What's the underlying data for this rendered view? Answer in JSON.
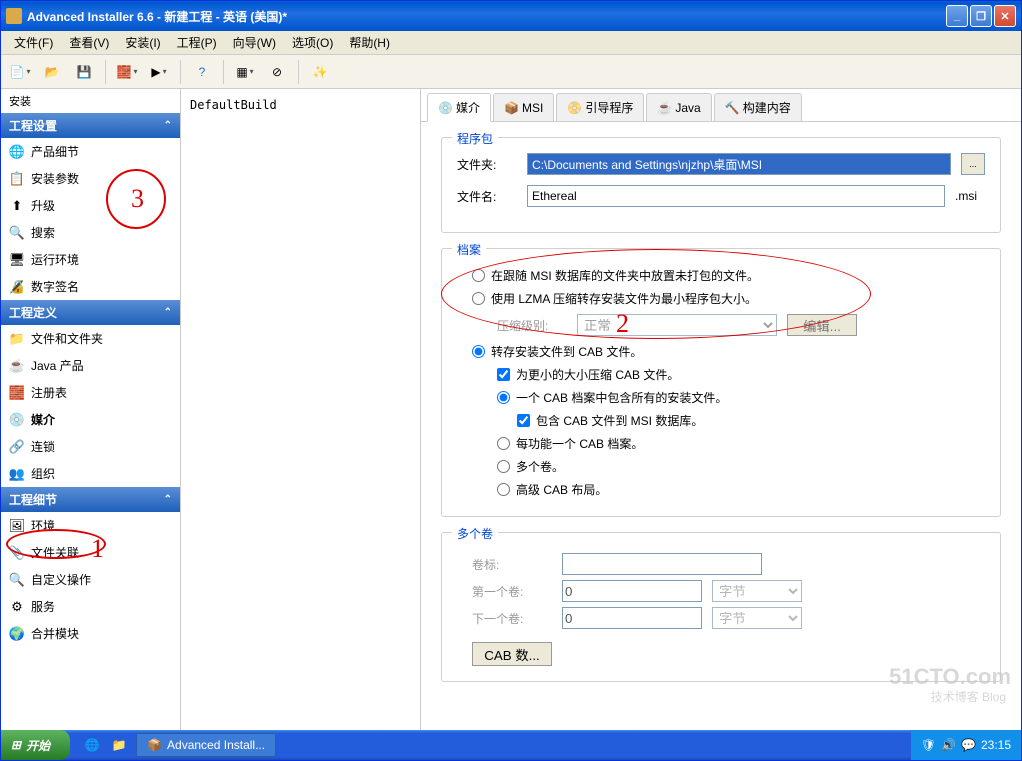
{
  "title": "Advanced Installer 6.6 - 新建工程 - 英语 (美国)*",
  "menu": {
    "file": "文件(F)",
    "view": "查看(V)",
    "install": "安装(I)",
    "project": "工程(P)",
    "wizard": "向导(W)",
    "options": "选项(O)",
    "help": "帮助(H)"
  },
  "sidebar_header": "安装",
  "sections": {
    "settings": {
      "title": "工程设置",
      "items": [
        "产品细节",
        "安装参数",
        "升级",
        "搜索",
        "运行环境",
        "数字签名"
      ]
    },
    "definition": {
      "title": "工程定义",
      "items": [
        "文件和文件夹",
        "Java 产品",
        "注册表",
        "媒介",
        "连锁",
        "组织"
      ]
    },
    "details": {
      "title": "工程细节",
      "items": [
        "环境",
        "文件关联",
        "自定义操作",
        "服务",
        "合并模块"
      ]
    }
  },
  "middle": {
    "build": "DefaultBuild"
  },
  "tabs": {
    "media": "媒介",
    "msi": "MSI",
    "bootstrap": "引导程序",
    "java": "Java",
    "build": "构建内容"
  },
  "package": {
    "legend": "程序包",
    "folder_label": "文件夹:",
    "folder_value": "C:\\Documents and Settings\\njzhp\\桌面\\MSI",
    "filename_label": "文件名:",
    "filename_value": "Ethereal",
    "ext": ".msi"
  },
  "archive": {
    "legend": "档案",
    "opt1": "在跟随 MSI 数据库的文件夹中放置未打包的文件。",
    "opt2": "使用 LZMA 压缩转存安装文件为最小程序包大小。",
    "compress_label": "压缩级别:",
    "compress_value": "正常",
    "edit_btn": "编辑...",
    "opt3": "转存安装文件到 CAB 文件。",
    "chk1": "为更小的大小压缩 CAB 文件。",
    "sub1": "一个 CAB 档案中包含所有的安装文件。",
    "chk2": "包含 CAB 文件到 MSI 数据库。",
    "sub2": "每功能一个 CAB 档案。",
    "sub3": "多个卷。",
    "sub4": "高级 CAB 布局。"
  },
  "volumes": {
    "legend": "多个卷",
    "label1": "卷标:",
    "label2": "第一个卷:",
    "label3": "下一个卷:",
    "val": "0",
    "unit": "字节",
    "cab_btn": "CAB 数..."
  },
  "taskbar": {
    "start": "开始",
    "app": "Advanced Install...",
    "time": "23:15"
  },
  "watermark": "51CTO.com",
  "watermark_sub": "技术博客  Blog",
  "annotations": {
    "a1": "1",
    "a2": "2",
    "a3": "3"
  }
}
